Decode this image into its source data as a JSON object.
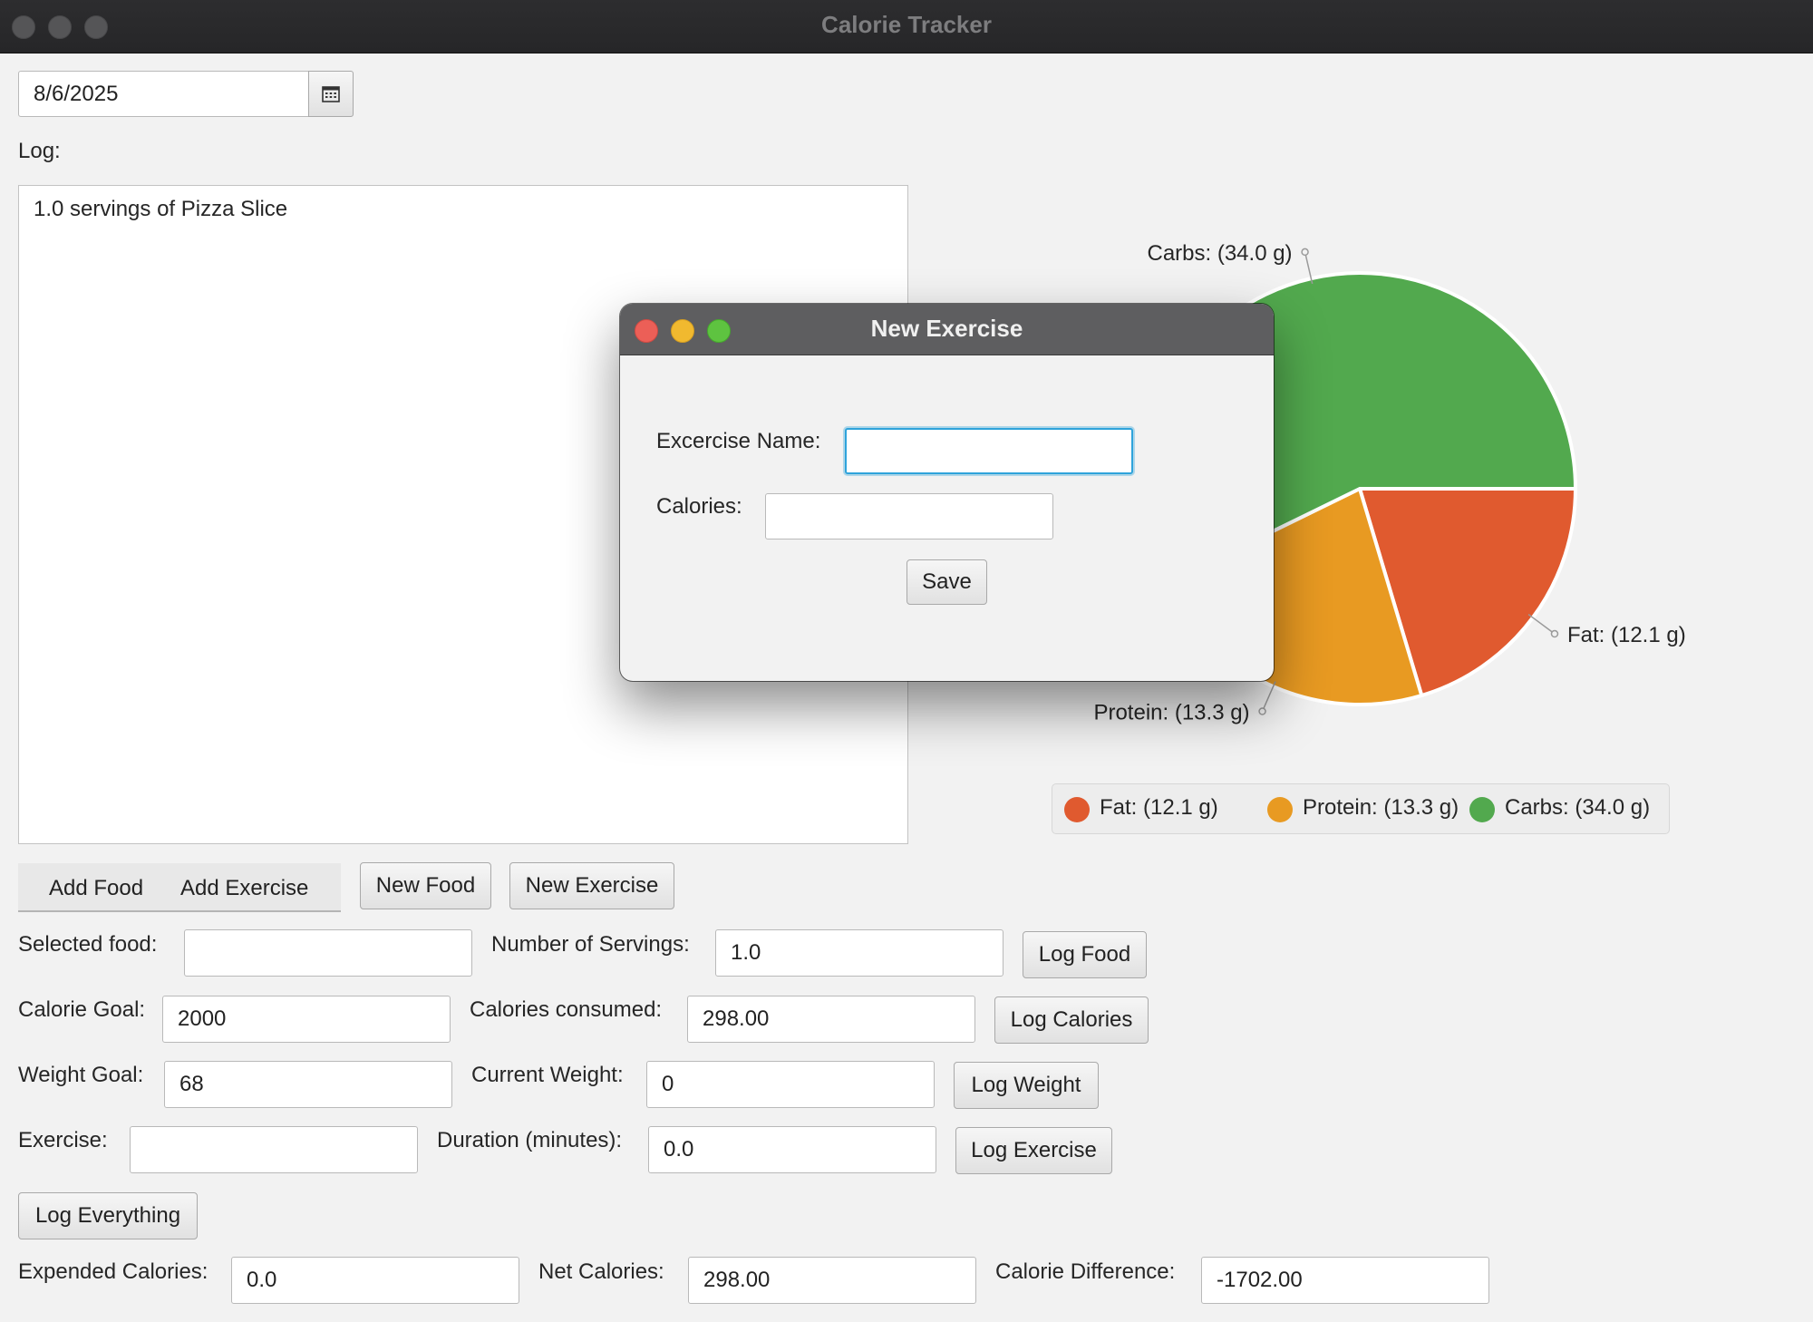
{
  "window": {
    "title": "Calorie Tracker"
  },
  "date_picker": {
    "value": "8/6/2025",
    "icon": "calendar-icon"
  },
  "log": {
    "label": "Log:",
    "entries": [
      "1.0 servings of Pizza Slice"
    ]
  },
  "tabs": [
    "Add Food",
    "Add Exercise"
  ],
  "buttons": {
    "new_food": "New Food",
    "new_exercise": "New Exercise",
    "log_food": "Log Food",
    "log_calories": "Log Calories",
    "log_weight": "Log Weight",
    "log_exercise": "Log Exercise",
    "log_everything": "Log Everything"
  },
  "form": {
    "selected_food": {
      "label": "Selected food:",
      "value": ""
    },
    "servings": {
      "label": "Number of Servings:",
      "value": "1.0"
    },
    "calorie_goal": {
      "label": "Calorie Goal:",
      "value": "2000"
    },
    "calories_consumed": {
      "label": "Calories consumed:",
      "value": "298.00"
    },
    "weight_goal": {
      "label": "Weight Goal:",
      "value": "68"
    },
    "current_weight": {
      "label": "Current Weight:",
      "value": "0"
    },
    "exercise": {
      "label": "Exercise:",
      "value": ""
    },
    "duration": {
      "label": "Duration (minutes):",
      "value": "0.0"
    },
    "expended": {
      "label": "Expended Calories:",
      "value": "0.0"
    },
    "net": {
      "label": "Net Calories:",
      "value": "298.00"
    },
    "difference": {
      "label": "Calorie Difference:",
      "value": "-1702.00"
    }
  },
  "dialog": {
    "title": "New Exercise",
    "name_label": "Excercise Name:",
    "name_value": "",
    "calories_label": "Calories:",
    "calories_value": "",
    "save_label": "Save"
  },
  "chart_data": {
    "type": "pie",
    "slices": [
      {
        "label": "Fat: (12.1 g)",
        "name": "Fat",
        "value": 12.1,
        "color": "#e05a2f"
      },
      {
        "label": "Protein: (13.3 g)",
        "name": "Protein",
        "value": 13.3,
        "color": "#e89a22"
      },
      {
        "label": "Carbs: (34.0 g)",
        "name": "Carbs",
        "value": 34.0,
        "color": "#52a94e"
      }
    ],
    "legend": [
      "Fat: (12.1 g)",
      "Protein: (13.3 g)",
      "Carbs: (34.0 g)"
    ],
    "legend_position": "bottom"
  }
}
